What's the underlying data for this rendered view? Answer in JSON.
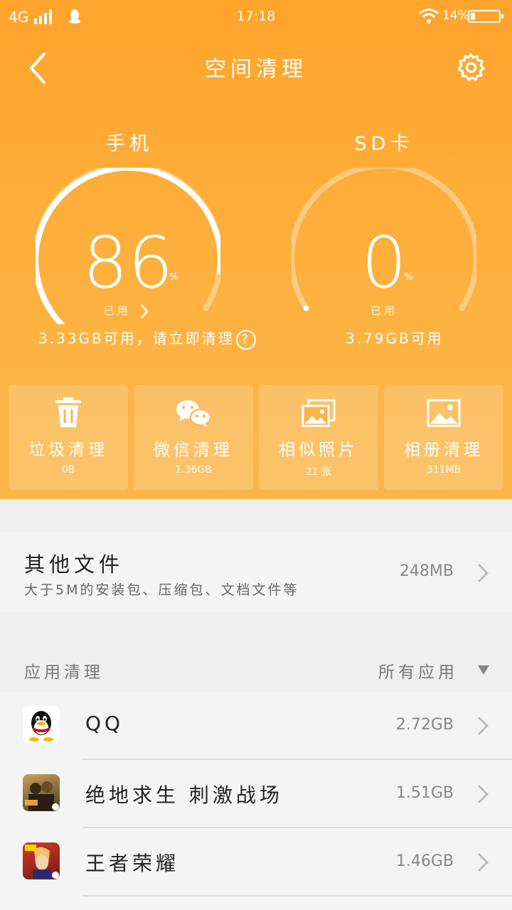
{
  "status_bar": {
    "network": "4G",
    "time": "17:18",
    "battery_pct": "14%",
    "battery_level": 0.14
  },
  "header": {
    "title": "空间清理"
  },
  "gauges": [
    {
      "label": "手机",
      "value": "86",
      "unit": "%",
      "used_label": "已用",
      "sub": "3.33GB可用，请立即清理",
      "percent": 86
    },
    {
      "label": "SD卡",
      "value": "0",
      "unit": "%",
      "used_label": "已用",
      "sub": "3.79GB可用",
      "percent": 0
    }
  ],
  "tiles": [
    {
      "name": "垃圾清理",
      "value": "0B",
      "icon": "trash-icon"
    },
    {
      "name": "微信清理",
      "value": "1.36GB",
      "icon": "wechat-icon"
    },
    {
      "name": "相似照片",
      "value": "21 张",
      "icon": "similar-photos-icon"
    },
    {
      "name": "相册清理",
      "value": "311MB",
      "icon": "album-icon"
    }
  ],
  "other_files": {
    "title": "其他文件",
    "subtitle": "大于5M的安装包、压缩包、文档文件等",
    "size": "248MB"
  },
  "app_section": {
    "title": "应用清理",
    "filter": "所有应用"
  },
  "apps": [
    {
      "name": "QQ",
      "size": "2.72GB",
      "icon": "qq-icon"
    },
    {
      "name": "绝地求生 刺激战场",
      "size": "1.51GB",
      "icon": "pubg-icon"
    },
    {
      "name": "王者荣耀",
      "size": "1.46GB",
      "icon": "honor-of-kings-icon"
    }
  ]
}
